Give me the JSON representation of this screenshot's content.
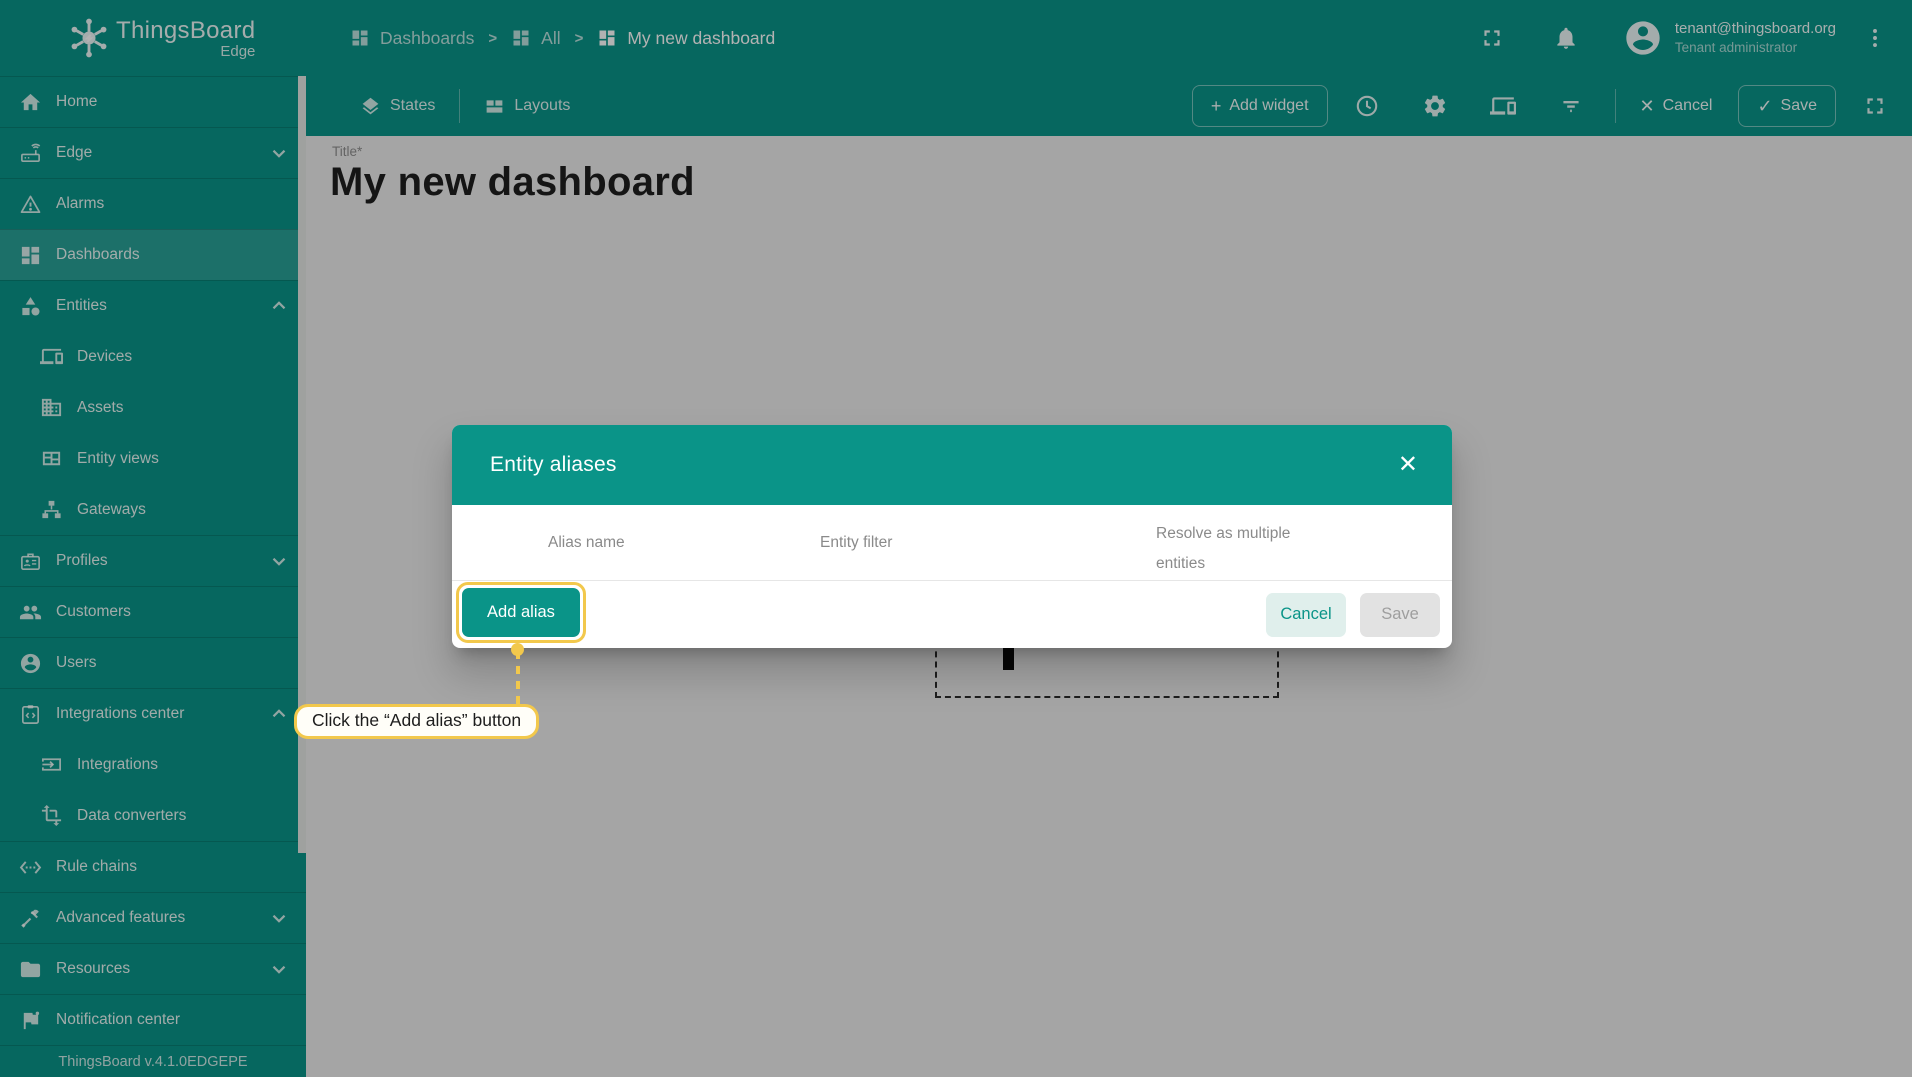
{
  "colors": {
    "primary": "#0a9488",
    "highlight": "#f2c84c",
    "content_bg": "#ededed"
  },
  "brand": {
    "name": "ThingsBoard",
    "edition": "Edge",
    "version": "ThingsBoard v.4.1.0EDGEPE"
  },
  "breadcrumb": {
    "separator": ">",
    "items": [
      {
        "label": "Dashboards"
      },
      {
        "label": "All"
      },
      {
        "label": "My new dashboard"
      }
    ]
  },
  "user": {
    "email": "tenant@thingsboard.org",
    "role": "Tenant administrator"
  },
  "sidebar": {
    "items": [
      {
        "label": "Home"
      },
      {
        "label": "Edge"
      },
      {
        "label": "Alarms"
      },
      {
        "label": "Dashboards"
      },
      {
        "label": "Entities"
      },
      {
        "label": "Devices"
      },
      {
        "label": "Assets"
      },
      {
        "label": "Entity views"
      },
      {
        "label": "Gateways"
      },
      {
        "label": "Profiles"
      },
      {
        "label": "Customers"
      },
      {
        "label": "Users"
      },
      {
        "label": "Integrations center"
      },
      {
        "label": "Integrations"
      },
      {
        "label": "Data converters"
      },
      {
        "label": "Rule chains"
      },
      {
        "label": "Advanced features"
      },
      {
        "label": "Resources"
      },
      {
        "label": "Notification center"
      }
    ]
  },
  "toolbar": {
    "states": "States",
    "layouts": "Layouts",
    "add_widget": "Add widget",
    "cancel": "Cancel",
    "save": "Save",
    "plus_glyph": "+",
    "check_glyph": "✓",
    "close_glyph": "✕"
  },
  "dashboard": {
    "title_label": "Title*",
    "title": "My new dashboard"
  },
  "dialog": {
    "title": "Entity aliases",
    "columns": [
      "Alias name",
      "Entity filter",
      "Resolve as multiple entities"
    ],
    "add_alias": "Add alias",
    "cancel": "Cancel",
    "save": "Save",
    "close_glyph": "✕"
  },
  "coach": {
    "tooltip": "Click the “Add alias” button"
  }
}
